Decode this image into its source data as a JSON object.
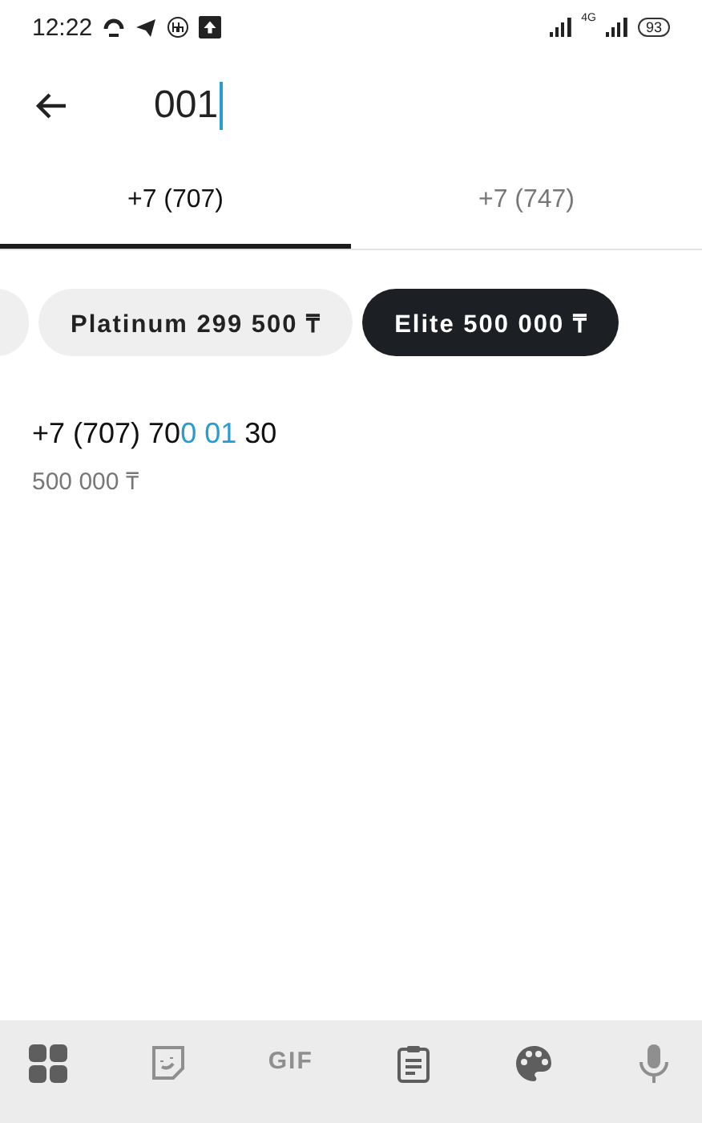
{
  "status_bar": {
    "time": "12:22",
    "network": "4G",
    "battery": "93"
  },
  "search": {
    "value": "001"
  },
  "tabs": [
    {
      "label": "+7 (707)",
      "selected": true
    },
    {
      "label": "+7 (747)",
      "selected": false
    }
  ],
  "chips": [
    {
      "selected": false
    },
    {
      "label": "Platinum 299 500 ₸",
      "selected": false
    },
    {
      "label": "Elite 500 000 ₸",
      "selected": true
    }
  ],
  "results": [
    {
      "number_start": "+7 (707) 70",
      "number_match": "0 01",
      "number_end": " 30",
      "price": "500 000 ₸"
    }
  ],
  "keyboard_toolbar": [
    {
      "kind": "apps",
      "disabled": false
    },
    {
      "kind": "sticker",
      "disabled": true
    },
    {
      "kind": "gif",
      "label": "GIF",
      "disabled": true
    },
    {
      "kind": "clipboard",
      "disabled": false
    },
    {
      "kind": "palette",
      "disabled": false
    },
    {
      "kind": "mic",
      "disabled": true
    }
  ]
}
